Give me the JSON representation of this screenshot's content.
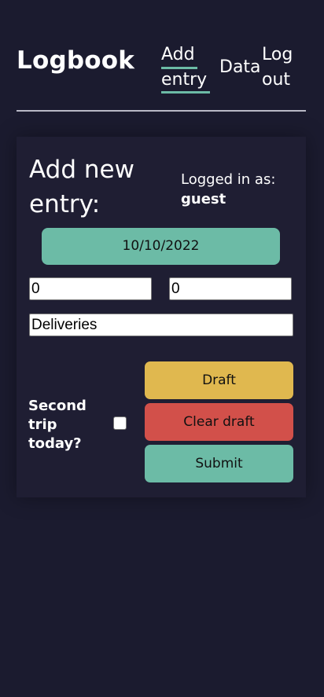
{
  "header": {
    "brand": "Logbook",
    "nav": {
      "add_entry_line1": "Add",
      "add_entry_line2": "entry",
      "data": "Data",
      "logout_line1": "Log",
      "logout_line2": "out"
    }
  },
  "form": {
    "title": "Add new entry:",
    "logged_in_label": "Logged in as:",
    "logged_in_user": "guest",
    "date": "10/10/2022",
    "field_a_value": "0",
    "field_b_value": "0",
    "description_value": "Deliveries",
    "second_trip": {
      "line1": "Second",
      "line2": "trip",
      "line3": "today?",
      "checked": false
    },
    "buttons": {
      "draft": "Draft",
      "clear_draft": "Clear draft",
      "submit": "Submit"
    }
  },
  "colors": {
    "background": "#1b1b2f",
    "card": "#1f1e33",
    "accent_green": "#6cbba6",
    "draft_yellow": "#e0b84f",
    "clear_red": "#d2504a"
  }
}
